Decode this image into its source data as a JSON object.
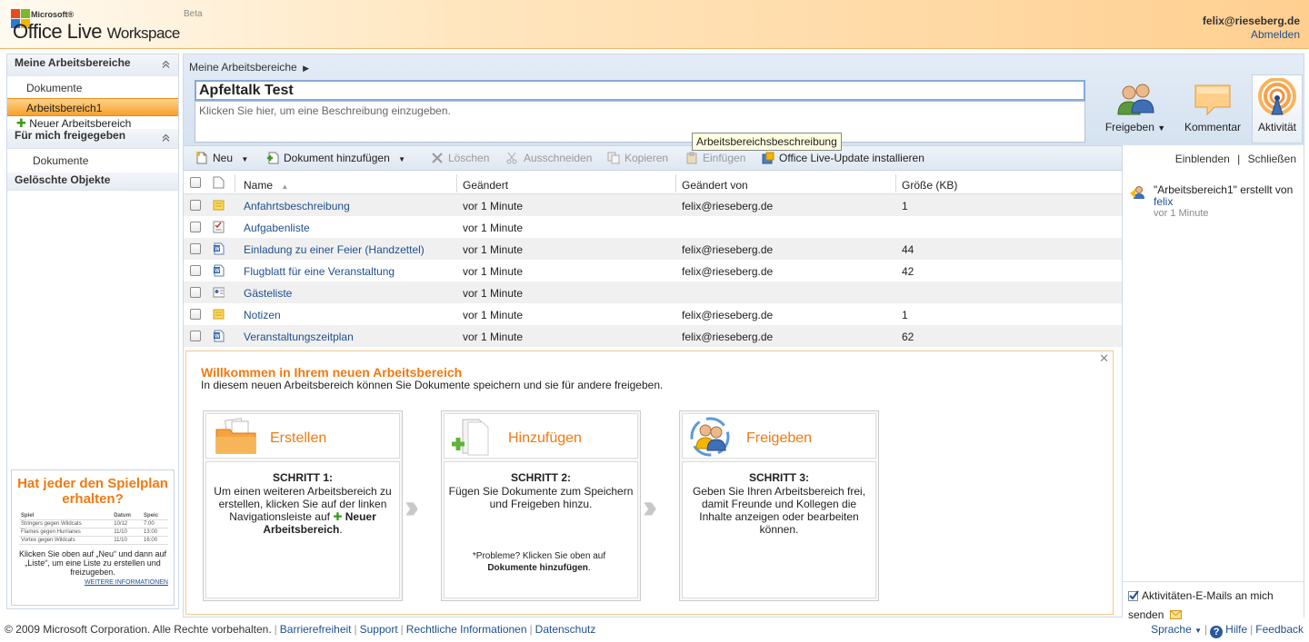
{
  "header": {
    "brand_ms": "Microsoft®",
    "brand_ol": "Office Live",
    "brand_ws": "Workspace",
    "beta": "Beta",
    "user_email": "felix@rieseberg.de",
    "logout": "Abmelden"
  },
  "nav": {
    "section1": "Meine Arbeitsbereiche",
    "item_documents": "Dokumente",
    "item_selected": "Arbeitsbereich1",
    "item_new": "Neuer Arbeitsbereich",
    "section2": "Für mich freigegeben",
    "item_shared_documents": "Dokumente",
    "section3": "Gelöschte Objekte"
  },
  "ad": {
    "title": "Hat jeder den Spielplan erhalten?",
    "columns": [
      "Spiel",
      "Datum",
      "Speic"
    ],
    "rows": [
      [
        "Stringers gegen Wildcats",
        "10/12",
        "7:00"
      ],
      [
        "Flames gegen Hurrianes",
        "11/10",
        "13:00"
      ],
      [
        "Vortex gegen Wildcats",
        "11/10",
        "16:00"
      ]
    ],
    "text": "Klicken Sie oben auf „Neu“ und dann auf „Liste“, um eine Liste zu erstellen und freizugeben.",
    "link": "WEITERE INFORMATIONEN"
  },
  "workspace": {
    "breadcrumb": "Meine Arbeitsbereiche",
    "title": "Apfeltalk Test",
    "description_placeholder": "Klicken Sie hier, um eine Beschreibung einzugeben.",
    "tooltip": "Arbeitsbereichsbeschreibung"
  },
  "share_buttons": {
    "share": "Freigeben",
    "comment": "Kommentar",
    "activity": "Aktivität"
  },
  "toolbar": {
    "new": "Neu",
    "add_document": "Dokument hinzufügen",
    "delete": "Löschen",
    "cut": "Ausschneiden",
    "copy": "Kopieren",
    "paste": "Einfügen",
    "update": "Office Live-Update installieren"
  },
  "table": {
    "columns": [
      "Name",
      "Geändert",
      "Geändert von",
      "Größe (KB)"
    ],
    "rows": [
      {
        "name": "Anfahrtsbeschreibung",
        "changed": "vor 1 Minute",
        "by": "felix@rieseberg.de",
        "size": "1",
        "icon": "note-icon"
      },
      {
        "name": "Aufgabenliste",
        "changed": "vor 1 Minute",
        "by": "",
        "size": "",
        "icon": "tasklist-icon"
      },
      {
        "name": "Einladung zu einer Feier (Handzettel)",
        "changed": "vor 1 Minute",
        "by": "felix@rieseberg.de",
        "size": "44",
        "icon": "word-doc-icon"
      },
      {
        "name": "Flugblatt für eine Veranstaltung",
        "changed": "vor 1 Minute",
        "by": "felix@rieseberg.de",
        "size": "42",
        "icon": "word-doc-icon"
      },
      {
        "name": "Gästeliste",
        "changed": "vor 1 Minute",
        "by": "",
        "size": "",
        "icon": "contact-list-icon"
      },
      {
        "name": "Notizen",
        "changed": "vor 1 Minute",
        "by": "felix@rieseberg.de",
        "size": "1",
        "icon": "note-icon"
      },
      {
        "name": "Veranstaltungszeitplan",
        "changed": "vor 1 Minute",
        "by": "felix@rieseberg.de",
        "size": "62",
        "icon": "word-doc-icon"
      }
    ]
  },
  "welcome": {
    "title": "Willkommen in Ihrem neuen Arbeitsbereich",
    "subtitle": "In diesem neuen Arbeitsbereich können Sie Dokumente speichern und sie für andere freigeben.",
    "step1_name": "Erstellen",
    "step1_label": "SCHRITT 1:",
    "step1_text_a": "Um einen weiteren Arbeitsbereich zu erstellen, klicken Sie auf der linken Navigationsleiste auf",
    "step1_text_b": "Neuer Arbeitsbereich",
    "step2_name": "Hinzufügen",
    "step2_label": "SCHRITT 2:",
    "step2_text": "Fügen Sie Dokumente zum Speichern und Freigeben hinzu.",
    "step2_note_a": "*Probleme? Klicken Sie oben auf",
    "step2_note_b": "Dokumente hinzufügen",
    "step3_name": "Freigeben",
    "step3_label": "SCHRITT 3:",
    "step3_text": "Geben Sie Ihren Arbeitsbereich frei, damit Freunde und Kollegen die Inhalte anzeigen oder bearbeiten können."
  },
  "rpanel": {
    "show": "Einblenden",
    "close": "Schließen",
    "activity_text": "\"Arbeitsbereich1\" erstellt von",
    "activity_user": "felix",
    "activity_time": "vor 1 Minute",
    "email_option": "Aktivitäten-E-Mails an mich senden"
  },
  "footer": {
    "copyright": "© 2009 Microsoft Corporation. Alle Rechte vorbehalten.",
    "accessibility": "Barrierefreiheit",
    "support": "Support",
    "legal": "Rechtliche Informationen",
    "privacy": "Datenschutz",
    "language": "Sprache",
    "help": "Hilfe",
    "feedback": "Feedback"
  },
  "colors": {
    "accent_orange": "#f07a12",
    "link_blue": "#1f4f8f",
    "selected_nav": "#f7a12c"
  }
}
